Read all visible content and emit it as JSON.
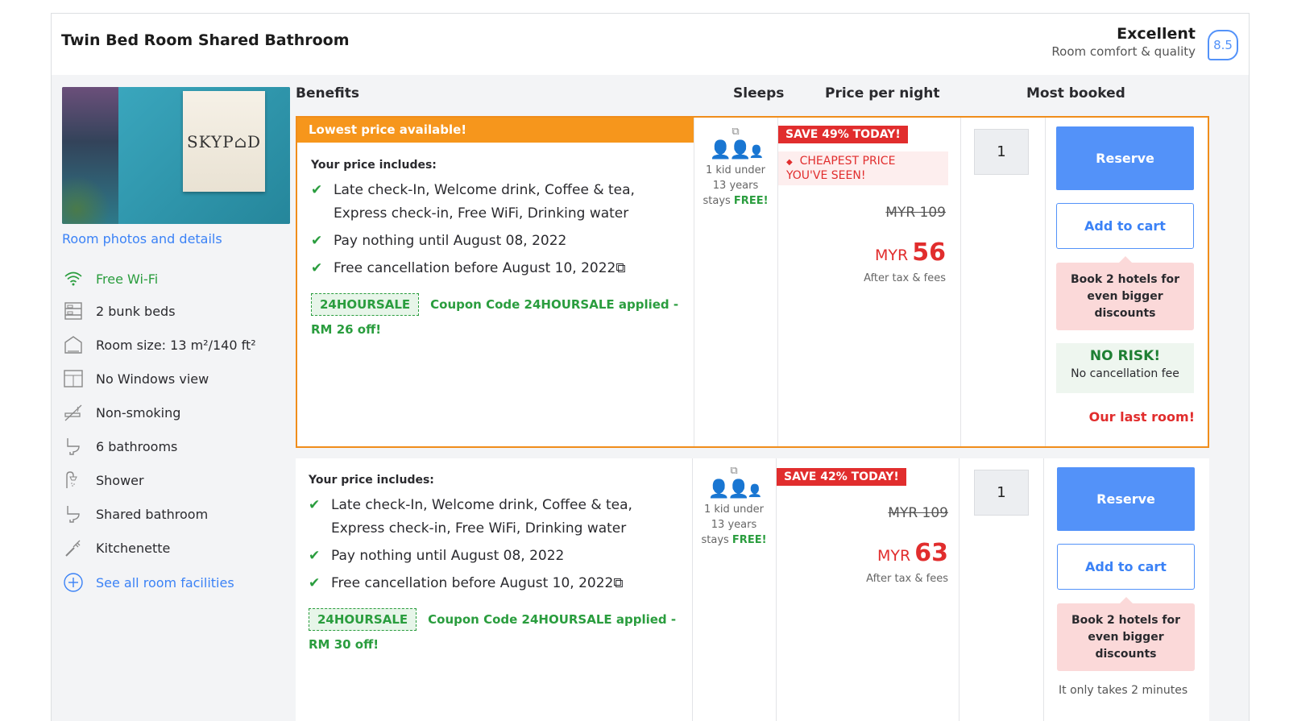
{
  "room": {
    "title": "Twin Bed Room Shared Bathroom",
    "rating_label": "Excellent",
    "rating_sub": "Room comfort & quality",
    "score": "8.5",
    "photo_sign": "SKYP⌂D",
    "photo_link": "Room photos and details"
  },
  "facilities": [
    {
      "icon": "wifi-icon",
      "label": "Free Wi-Fi"
    },
    {
      "icon": "bunk-bed-icon",
      "label": "2 bunk beds"
    },
    {
      "icon": "room-size-icon",
      "label": "Room size: 13 m²/140 ft²"
    },
    {
      "icon": "window-icon",
      "label": "No Windows view"
    },
    {
      "icon": "no-smoking-icon",
      "label": "Non-smoking"
    },
    {
      "icon": "toilet-icon",
      "label": "6 bathrooms"
    },
    {
      "icon": "shower-icon",
      "label": "Shower"
    },
    {
      "icon": "toilet-icon",
      "label": "Shared bathroom"
    },
    {
      "icon": "kitchen-icon",
      "label": "Kitchenette"
    },
    {
      "icon": "plus-circle-icon",
      "label": "See all room facilities"
    }
  ],
  "headers": {
    "benefits": "Benefits",
    "sleeps": "Sleeps",
    "price": "Price per night",
    "most_booked": "Most booked"
  },
  "offers": [
    {
      "banner": "Lowest price available!",
      "includes_title": "Your price includes:",
      "bullets": [
        "Late check-In, Welcome drink, Coffee & tea,",
        "Express check-in, Free WiFi, Drinking water",
        "Pay nothing until August 08, 2022",
        "Free cancellation before August 10, 2022⧉"
      ],
      "coupon_code": "24HOURSALE",
      "coupon_text": "Coupon Code 24HOURSALE applied -",
      "coupon_off": "RM 26 off!",
      "sleeps": {
        "line1": "1 kid under",
        "line2": "13 years",
        "line3a": "stays ",
        "line3b": "FREE!"
      },
      "save_badge": "SAVE 49% TODAY!",
      "cheapest": "CHEAPEST PRICE YOU'VE SEEN!",
      "old_price": "MYR 109",
      "currency": "MYR",
      "price": "56",
      "tax_note": "After tax & fees",
      "qty": "1",
      "reserve": "Reserve",
      "add_to_cart": "Add to cart",
      "promo": "Book 2 hotels for even bigger discounts",
      "no_risk_title": "NO RISK!",
      "no_risk_sub": "No cancellation fee",
      "last_room": "Our last room!"
    },
    {
      "includes_title": "Your price includes:",
      "bullets": [
        "Late check-In, Welcome drink, Coffee & tea,",
        "Express check-in, Free WiFi, Drinking water",
        "Pay nothing until August 08, 2022",
        "Free cancellation before August 10, 2022⧉"
      ],
      "coupon_code": "24HOURSALE",
      "coupon_text": "Coupon Code 24HOURSALE applied -",
      "coupon_off": "RM 30 off!",
      "sleeps": {
        "line1": "1 kid under",
        "line2": "13 years",
        "line3a": "stays ",
        "line3b": "FREE!"
      },
      "save_badge": "SAVE 42% TODAY!",
      "old_price": "MYR 109",
      "currency": "MYR",
      "price": "63",
      "tax_note": "After tax & fees",
      "qty": "1",
      "reserve": "Reserve",
      "add_to_cart": "Add to cart",
      "promo": "Book 2 hotels for even bigger discounts",
      "minutes_note": "It only takes 2 minutes"
    }
  ],
  "colors": {
    "accent_blue": "#5392f9",
    "orange": "#f6961c",
    "red": "#e12d2d",
    "green": "#2a9d3e"
  }
}
